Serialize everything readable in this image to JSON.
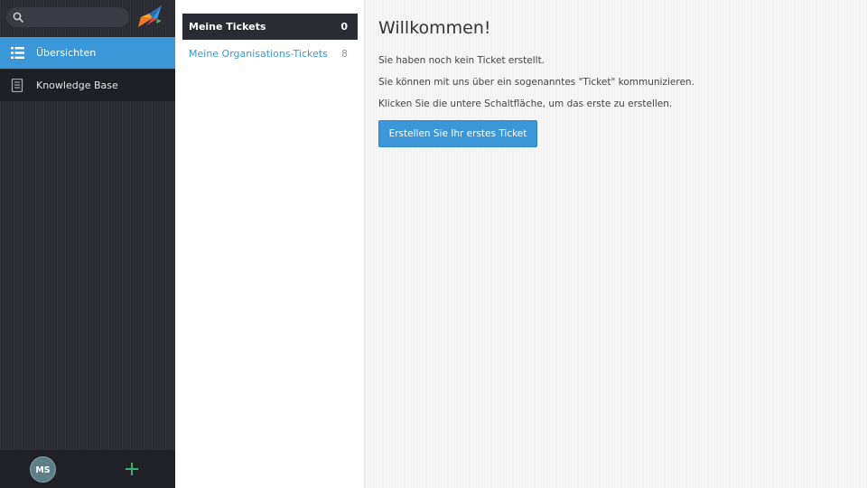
{
  "sidebar": {
    "search_placeholder": "",
    "items": [
      {
        "label": "Übersichten",
        "icon": "list-icon",
        "active": true
      },
      {
        "label": "Knowledge Base",
        "icon": "book-icon",
        "active": false
      }
    ],
    "user_initials": "MS"
  },
  "overviews": [
    {
      "name": "Meine Tickets",
      "count": "0"
    },
    {
      "name": "Meine Organisations-Tickets",
      "count": "8"
    }
  ],
  "main": {
    "title": "Willkommen!",
    "line1": "Sie haben noch kein Ticket erstellt.",
    "line2": "Sie können mit uns über ein sogenanntes \"Ticket\" kommunizieren.",
    "line3": "Klicken Sie die untere Schaltfläche, um das erste zu erstellen.",
    "button": "Erstellen Sie Ihr erstes Ticket"
  },
  "colors": {
    "accent": "#3b97d8",
    "nav_bg": "#2a2b33",
    "add_green": "#3ab36f"
  }
}
